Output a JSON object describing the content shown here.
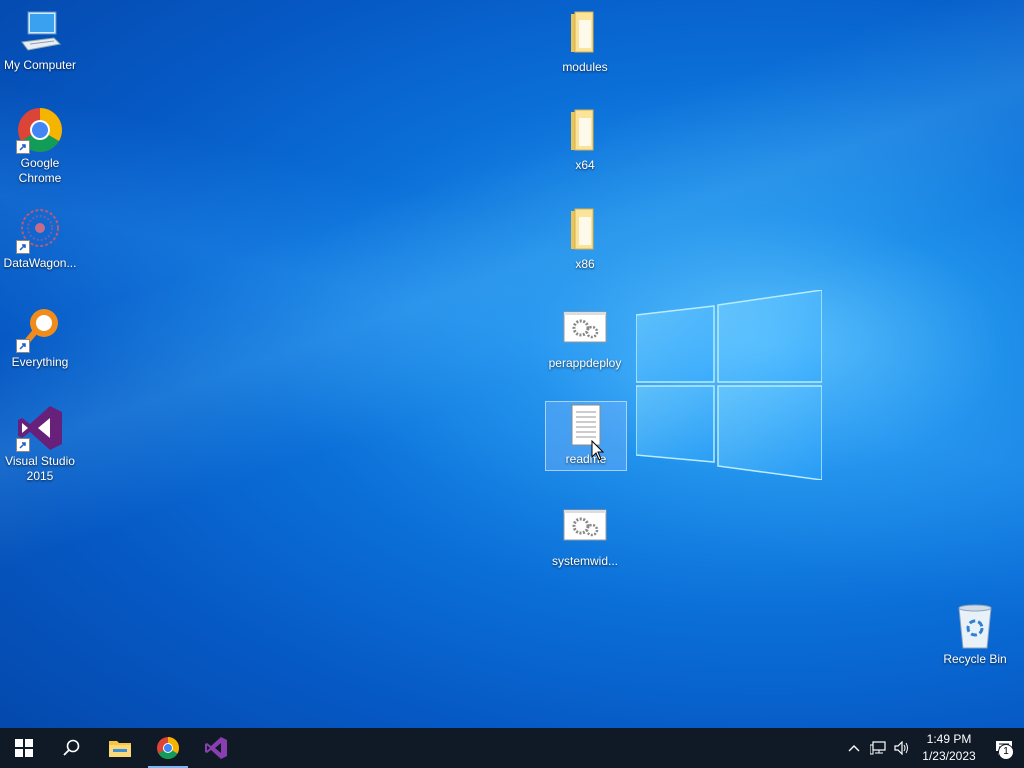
{
  "desktop": {
    "left_icons": [
      {
        "label": "My Computer",
        "icon": "computer-icon",
        "shortcut": false
      },
      {
        "label": "Google Chrome",
        "icon": "chrome-icon",
        "shortcut": true
      },
      {
        "label": "DataWagon...",
        "icon": "datawagon-icon",
        "shortcut": true
      },
      {
        "label": "Everything",
        "icon": "everything-icon",
        "shortcut": true
      },
      {
        "label": "Visual Studio 2015",
        "icon": "visual-studio-icon",
        "shortcut": true
      }
    ],
    "center_icons": [
      {
        "label": "modules",
        "icon": "folder-icon"
      },
      {
        "label": "x64",
        "icon": "folder-icon"
      },
      {
        "label": "x86",
        "icon": "folder-icon"
      },
      {
        "label": "perappdeploy",
        "icon": "settings-file-icon"
      },
      {
        "label": "readme",
        "icon": "text-file-icon",
        "selected": true
      },
      {
        "label": "systemwid...",
        "icon": "settings-file-icon"
      }
    ],
    "recycle_bin": {
      "label": "Recycle Bin",
      "icon": "recycle-bin-icon"
    }
  },
  "taskbar": {
    "pinned": [
      "start-icon",
      "search-icon",
      "file-explorer-icon",
      "chrome-icon",
      "visual-studio-icon"
    ],
    "active_app": "chrome-icon",
    "clock": {
      "time": "1:49 PM",
      "date": "1/23/2023"
    },
    "notifications_count": "1"
  }
}
